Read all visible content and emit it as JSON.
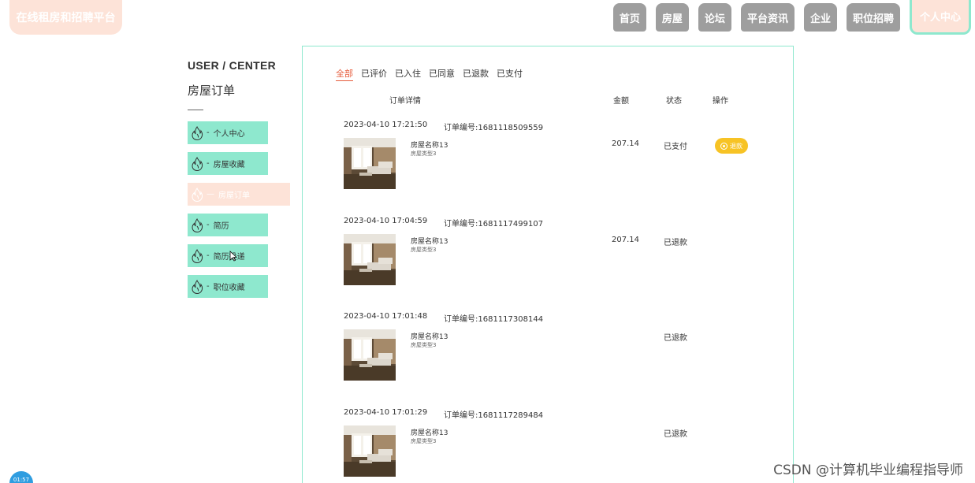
{
  "app": {
    "logo_text": "在线租房和招聘平台"
  },
  "nav": {
    "items": [
      {
        "label": "首页"
      },
      {
        "label": "房屋"
      },
      {
        "label": "论坛"
      },
      {
        "label": "平台资讯"
      },
      {
        "label": "企业"
      },
      {
        "label": "职位招聘"
      },
      {
        "label": "个人中心"
      }
    ],
    "active_index": 6
  },
  "sidebar": {
    "title_en": "USER / CENTER",
    "title_cn": "房屋订单",
    "items": [
      {
        "label": "个人中心",
        "icon": "flame-icon"
      },
      {
        "label": "房屋收藏",
        "icon": "flame-icon"
      },
      {
        "label": "房屋订单",
        "icon": "flame-icon"
      },
      {
        "label": "简历",
        "icon": "flame-icon"
      },
      {
        "label": "简历投递",
        "icon": "flame-icon"
      },
      {
        "label": "职位收藏",
        "icon": "flame-icon"
      }
    ],
    "active_index": 2
  },
  "tabs": [
    {
      "label": "全部"
    },
    {
      "label": "已评价"
    },
    {
      "label": "已入住"
    },
    {
      "label": "已同意"
    },
    {
      "label": "已退款"
    },
    {
      "label": "已支付"
    }
  ],
  "columns": {
    "detail": "订单详情",
    "amount": "金额",
    "status": "状态",
    "action": "操作"
  },
  "orders": [
    {
      "date": "2023-04-10 17:21:50",
      "order_no": "订单编号:1681118509559",
      "house_name": "房屋名称13",
      "house_type": "房屋类型3",
      "amount": "207.14",
      "status": "已支付",
      "action": "退款"
    },
    {
      "date": "2023-04-10 17:04:59",
      "order_no": "订单编号:1681117499107",
      "house_name": "房屋名称13",
      "house_type": "房屋类型3",
      "amount": "207.14",
      "status": "已退款",
      "action": ""
    },
    {
      "date": "2023-04-10 17:01:48",
      "order_no": "订单编号:1681117308144",
      "house_name": "房屋名称13",
      "house_type": "房屋类型3",
      "amount": "",
      "status": "已退款",
      "action": ""
    },
    {
      "date": "2023-04-10 17:01:29",
      "order_no": "订单编号:1681117289484",
      "house_name": "房屋名称13",
      "house_type": "房屋类型3",
      "amount": "",
      "status": "已退款",
      "action": ""
    }
  ],
  "timer": "01:57",
  "watermark": "CSDN @计算机毕业编程指导师",
  "colors": {
    "accent_mint": "#8ee8ce",
    "accent_peach": "#fde3d8",
    "nav_gray": "#9e9e9e",
    "active_tab": "#e65c3c",
    "refund": "#f7c325"
  }
}
